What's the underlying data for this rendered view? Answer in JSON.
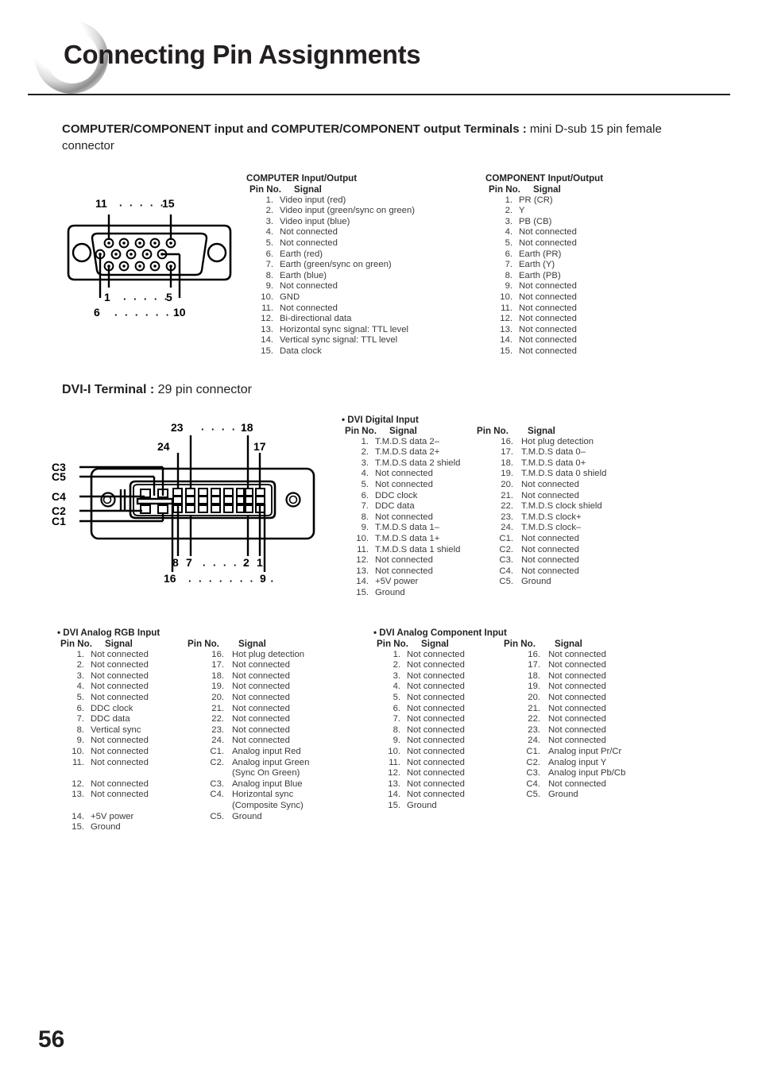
{
  "page": {
    "title": "Connecting Pin Assignments",
    "number": "56"
  },
  "sections": {
    "computer_component": {
      "heading_bold": "COMPUTER/COMPONENT input and COMPUTER/COMPONENT output Terminals :",
      "heading_rest": " mini D-sub 15 pin female connector"
    },
    "dvi": {
      "heading_bold": "DVI-I Terminal :",
      "heading_rest": " 29 pin connector"
    }
  },
  "dsub_diagram": {
    "name": "mini-dsub-15-connector",
    "labels": {
      "top_left": "11",
      "top_right": "15",
      "mid_left": "1",
      "mid_right": "5",
      "bottom_left": "6",
      "bottom_right": "10"
    },
    "dots_top": "· · · · ·",
    "dots_mid": "· · · · ·",
    "dots_bottom": "· · · · · · ·"
  },
  "dvi_diagram": {
    "name": "dvi-i-29-pin-connector",
    "labels": {
      "t23": "23",
      "t18": "18",
      "t24": "24",
      "t17": "17",
      "c3": "C3",
      "c5": "C5",
      "c4": "C4",
      "c2": "C2",
      "c1": "C1",
      "b8": "8",
      "b7": "7",
      "b2": "2",
      "b1": "1",
      "b16": "16",
      "b9": "9"
    },
    "dots_top": "· · · · ·",
    "dots_bottom_inner": "· · · · ·",
    "dots_bottom_outer": "· · · · · · · · ·"
  },
  "tables": {
    "computer_io": {
      "title": "COMPUTER Input/Output",
      "col_pin": "Pin No.",
      "col_signal": "Signal",
      "rows": [
        {
          "no": "1.",
          "sig": "Video input (red)"
        },
        {
          "no": "2.",
          "sig": "Video input (green/sync on green)"
        },
        {
          "no": "3.",
          "sig": "Video input (blue)"
        },
        {
          "no": "4.",
          "sig": "Not connected"
        },
        {
          "no": "5.",
          "sig": "Not connected"
        },
        {
          "no": "6.",
          "sig": "Earth (red)"
        },
        {
          "no": "7.",
          "sig": "Earth (green/sync on green)"
        },
        {
          "no": "8.",
          "sig": "Earth (blue)"
        },
        {
          "no": "9.",
          "sig": "Not connected"
        },
        {
          "no": "10.",
          "sig": "GND"
        },
        {
          "no": "11.",
          "sig": "Not connected"
        },
        {
          "no": "12.",
          "sig": "Bi-directional data"
        },
        {
          "no": "13.",
          "sig": "Horizontal sync signal: TTL level"
        },
        {
          "no": "14.",
          "sig": "Vertical sync signal: TTL level"
        },
        {
          "no": "15.",
          "sig": "Data clock"
        }
      ]
    },
    "component_io": {
      "title": "COMPONENT Input/Output",
      "col_pin": "Pin No.",
      "col_signal": "Signal",
      "rows": [
        {
          "no": "1.",
          "sig": "PR (CR)"
        },
        {
          "no": "2.",
          "sig": "Y"
        },
        {
          "no": "3.",
          "sig": "PB (CB)"
        },
        {
          "no": "4.",
          "sig": "Not connected"
        },
        {
          "no": "5.",
          "sig": "Not connected"
        },
        {
          "no": "6.",
          "sig": "Earth (PR)"
        },
        {
          "no": "7.",
          "sig": "Earth (Y)"
        },
        {
          "no": "8.",
          "sig": "Earth (PB)"
        },
        {
          "no": "9.",
          "sig": "Not connected"
        },
        {
          "no": "10.",
          "sig": "Not connected"
        },
        {
          "no": "11.",
          "sig": "Not connected"
        },
        {
          "no": "12.",
          "sig": "Not connected"
        },
        {
          "no": "13.",
          "sig": "Not connected"
        },
        {
          "no": "14.",
          "sig": "Not connected"
        },
        {
          "no": "15.",
          "sig": "Not connected"
        }
      ]
    },
    "dvi_digital": {
      "title": "• DVI Digital Input",
      "col_pin": "Pin No.",
      "col_signal": "Signal",
      "col_pin2": "Pin No.",
      "col_signal2": "Signal",
      "left_rows": [
        {
          "no": "1.",
          "sig": "T.M.D.S data 2–"
        },
        {
          "no": "2.",
          "sig": "T.M.D.S data 2+"
        },
        {
          "no": "3.",
          "sig": "T.M.D.S data 2 shield"
        },
        {
          "no": "4.",
          "sig": "Not connected"
        },
        {
          "no": "5.",
          "sig": "Not connected"
        },
        {
          "no": "6.",
          "sig": "DDC clock"
        },
        {
          "no": "7.",
          "sig": "DDC data"
        },
        {
          "no": "8.",
          "sig": "Not connected"
        },
        {
          "no": "9.",
          "sig": "T.M.D.S data 1–"
        },
        {
          "no": "10.",
          "sig": "T.M.D.S data 1+"
        },
        {
          "no": "11.",
          "sig": "T.M.D.S data 1 shield"
        },
        {
          "no": "12.",
          "sig": "Not connected"
        },
        {
          "no": "13.",
          "sig": "Not connected"
        },
        {
          "no": "14.",
          "sig": "+5V power"
        },
        {
          "no": "15.",
          "sig": "Ground"
        }
      ],
      "right_rows": [
        {
          "no": "16.",
          "sig": "Hot plug detection"
        },
        {
          "no": "17.",
          "sig": "T.M.D.S data 0–"
        },
        {
          "no": "18.",
          "sig": "T.M.D.S data 0+"
        },
        {
          "no": "19.",
          "sig": "T.M.D.S data 0 shield"
        },
        {
          "no": "20.",
          "sig": "Not connected"
        },
        {
          "no": "21.",
          "sig": "Not connected"
        },
        {
          "no": "22.",
          "sig": "T.M.D.S clock shield"
        },
        {
          "no": "23.",
          "sig": "T.M.D.S clock+"
        },
        {
          "no": "24.",
          "sig": "T.M.D.S clock–"
        },
        {
          "no": "C1.",
          "sig": "Not connected"
        },
        {
          "no": "C2.",
          "sig": "Not connected"
        },
        {
          "no": "C3.",
          "sig": "Not connected"
        },
        {
          "no": "C4.",
          "sig": "Not connected"
        },
        {
          "no": "C5.",
          "sig": "Ground"
        }
      ]
    },
    "dvi_analog_rgb": {
      "title": "• DVI Analog RGB Input",
      "col_pin": "Pin No.",
      "col_signal": "Signal",
      "col_pin2": "Pin No.",
      "col_signal2": "Signal",
      "left_rows": [
        {
          "no": "1.",
          "sig": "Not connected"
        },
        {
          "no": "2.",
          "sig": "Not connected"
        },
        {
          "no": "3.",
          "sig": "Not connected"
        },
        {
          "no": "4.",
          "sig": "Not connected"
        },
        {
          "no": "5.",
          "sig": "Not connected"
        },
        {
          "no": "6.",
          "sig": "DDC clock"
        },
        {
          "no": "7.",
          "sig": "DDC data"
        },
        {
          "no": "8.",
          "sig": "Vertical sync"
        },
        {
          "no": "9.",
          "sig": "Not connected"
        },
        {
          "no": "10.",
          "sig": "Not connected"
        },
        {
          "no": "11.",
          "sig": "Not connected"
        },
        {
          "no": "",
          "sig": ""
        },
        {
          "no": "12.",
          "sig": "Not connected"
        },
        {
          "no": "13.",
          "sig": "Not connected"
        },
        {
          "no": "",
          "sig": ""
        },
        {
          "no": "14.",
          "sig": "+5V power"
        },
        {
          "no": "15.",
          "sig": "Ground"
        }
      ],
      "right_rows": [
        {
          "no": "16.",
          "sig": "Hot plug detection"
        },
        {
          "no": "17.",
          "sig": "Not connected"
        },
        {
          "no": "18.",
          "sig": "Not connected"
        },
        {
          "no": "19.",
          "sig": "Not connected"
        },
        {
          "no": "20.",
          "sig": "Not connected"
        },
        {
          "no": "21.",
          "sig": "Not connected"
        },
        {
          "no": "22.",
          "sig": "Not connected"
        },
        {
          "no": "23.",
          "sig": "Not connected"
        },
        {
          "no": "24.",
          "sig": "Not connected"
        },
        {
          "no": "C1.",
          "sig": "Analog input Red"
        },
        {
          "no": "C2.",
          "sig": "Analog input Green"
        },
        {
          "no": "",
          "sig": "(Sync On Green)"
        },
        {
          "no": "C3.",
          "sig": "Analog input Blue"
        },
        {
          "no": "C4.",
          "sig": "Horizontal sync"
        },
        {
          "no": "",
          "sig": "(Composite Sync)"
        },
        {
          "no": "C5.",
          "sig": "Ground"
        },
        {
          "no": "",
          "sig": ""
        }
      ]
    },
    "dvi_analog_component": {
      "title": "• DVI Analog Component Input",
      "col_pin": "Pin No.",
      "col_signal": "Signal",
      "col_pin2": "Pin No.",
      "col_signal2": "Signal",
      "left_rows": [
        {
          "no": "1.",
          "sig": "Not connected"
        },
        {
          "no": "2.",
          "sig": "Not connected"
        },
        {
          "no": "3.",
          "sig": "Not connected"
        },
        {
          "no": "4.",
          "sig": "Not connected"
        },
        {
          "no": "5.",
          "sig": "Not connected"
        },
        {
          "no": "6.",
          "sig": "Not connected"
        },
        {
          "no": "7.",
          "sig": "Not connected"
        },
        {
          "no": "8.",
          "sig": "Not connected"
        },
        {
          "no": "9.",
          "sig": "Not connected"
        },
        {
          "no": "10.",
          "sig": "Not connected"
        },
        {
          "no": "11.",
          "sig": "Not connected"
        },
        {
          "no": "12.",
          "sig": "Not connected"
        },
        {
          "no": "13.",
          "sig": "Not connected"
        },
        {
          "no": "14.",
          "sig": "Not connected"
        },
        {
          "no": "15.",
          "sig": "Ground"
        }
      ],
      "right_rows": [
        {
          "no": "16.",
          "sig": "Not connected"
        },
        {
          "no": "17.",
          "sig": "Not connected"
        },
        {
          "no": "18.",
          "sig": "Not connected"
        },
        {
          "no": "19.",
          "sig": "Not connected"
        },
        {
          "no": "20.",
          "sig": "Not connected"
        },
        {
          "no": "21.",
          "sig": "Not connected"
        },
        {
          "no": "22.",
          "sig": "Not connected"
        },
        {
          "no": "23.",
          "sig": "Not connected"
        },
        {
          "no": "24.",
          "sig": "Not connected"
        },
        {
          "no": "C1.",
          "sig": "Analog input Pr/Cr"
        },
        {
          "no": "C2.",
          "sig": "Analog input Y"
        },
        {
          "no": "C3.",
          "sig": "Analog input Pb/Cb"
        },
        {
          "no": "C4.",
          "sig": "Not connected"
        },
        {
          "no": "C5.",
          "sig": "Ground"
        },
        {
          "no": "",
          "sig": ""
        }
      ]
    }
  }
}
